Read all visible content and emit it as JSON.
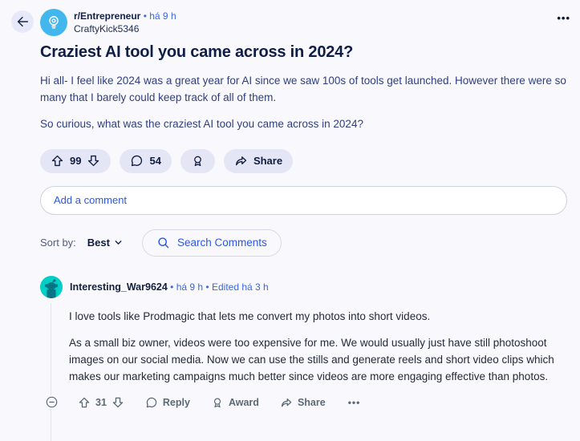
{
  "header": {
    "subreddit": "r/Entrepreneur",
    "separator": "•",
    "time": "há 9 h",
    "author": "CraftyKick5346",
    "overflow_icon": "•••"
  },
  "post": {
    "title": "Craziest AI tool you came across in 2024?",
    "paragraphs": {
      "p1": "Hi all- I feel like 2024 was a great year for AI since we saw 100s of tools get launched. However there were so many that I barely could keep track of all of them.",
      "p2": "So curious, what was the craziest AI tool you came across in 2024?"
    },
    "actions": {
      "upvotes": "99",
      "comments": "54",
      "share": "Share"
    }
  },
  "comment_composer": {
    "placeholder": "Add a comment"
  },
  "controls": {
    "sort_label": "Sort by:",
    "sort_value": "Best",
    "search_label": "Search Comments"
  },
  "comment": {
    "author": "Interesting_War9624",
    "separator": "•",
    "time": "há 9 h",
    "edited": "Edited há 3 h",
    "paragraphs": {
      "p1": "I love tools like Prodmagic that lets me convert my photos into short videos.",
      "p2": "As a small biz owner, videos were too expensive for me. We would usually just have still photoshoot images on our social media. Now we can use the stills and generate reels and short video clips which makes our marketing campaigns much better since videos are more engaging effective than photos."
    },
    "actions": {
      "upvotes": "31",
      "reply": "Reply",
      "award": "Award",
      "share": "Share",
      "overflow_icon": "•••"
    }
  },
  "colors": {
    "background": "#f9f9fd",
    "accent_blue": "#2c58e2",
    "title_navy": "#0f1d49",
    "body_indigo": "#2f3f7e",
    "pill_bg": "#e4e6f6",
    "slate": "#5a6a76",
    "subreddit_avatar_bg": "#41b7ee",
    "comment_avatar_bg": "#00cfc7"
  }
}
